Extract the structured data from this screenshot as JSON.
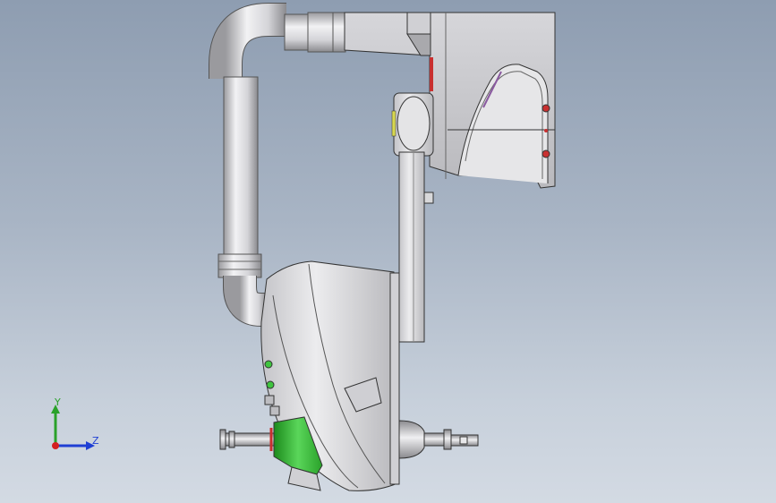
{
  "viewport": {
    "background_top": "#8e9db1",
    "background_bottom": "#d3dae3"
  },
  "model": {
    "description_icon": "robot-arm-icon",
    "colors": {
      "body": "#d8d8da",
      "edge": "#333333",
      "accent_green": "#3fc43f",
      "accent_red": "#c83030",
      "accent_yellow": "#d8d850"
    }
  },
  "triad": {
    "y_label": "Y",
    "z_label": "Z",
    "y_color": "#2aa12a",
    "z_color": "#1f3fd4",
    "x_color": "#d42020"
  }
}
